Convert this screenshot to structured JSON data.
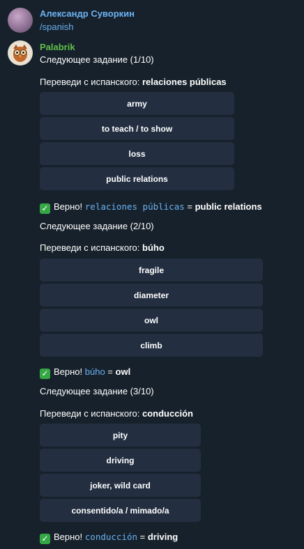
{
  "user_message": {
    "sender": "Александр Суворкин",
    "text": "/spanish",
    "sender_color": "#6ab2f2"
  },
  "bot": {
    "sender": "Palabrik",
    "sender_color": "#5fbf4a",
    "avatar_icon": "owl-icon",
    "blocks": [
      {
        "task_text": "Следующее задание (1/10)",
        "prompt_prefix": "Переведи с испанского: ",
        "prompt_word": "relaciones públicas",
        "options": [
          "army",
          "to teach / to show",
          "loss",
          "public relations"
        ],
        "result_prefix": "Верно! ",
        "result_word": "relaciones públicas",
        "result_eq": " = ",
        "result_answer": "public relations"
      },
      {
        "task_text": "Следующее задание (2/10)",
        "prompt_prefix": "Переведи с испанского: ",
        "prompt_word": "búho",
        "options": [
          "fragile",
          "diameter",
          "owl",
          "climb"
        ],
        "result_prefix": "Верно! ",
        "result_word": "búho",
        "result_eq": " = ",
        "result_answer": "owl"
      },
      {
        "task_text": "Следующее задание (3/10)",
        "prompt_prefix": "Переведи с испанского: ",
        "prompt_word": "conducción",
        "options": [
          "pity",
          "driving",
          "joker, wild card",
          "consentido/a / mimado/a"
        ],
        "result_prefix": "Верно! ",
        "result_word": "conducción",
        "result_eq": " = ",
        "result_answer": "driving"
      }
    ]
  },
  "colors": {
    "background": "#17212b",
    "button_bg": "#232f41",
    "accent_blue": "#6ab2f2",
    "check_green": "#35a846"
  }
}
